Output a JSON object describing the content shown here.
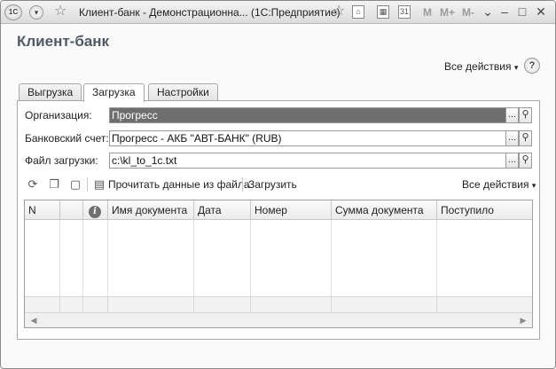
{
  "window": {
    "title": "Клиент-банк - Демонстрационна... (1С:Предприятие)",
    "logo_text": "1С",
    "m_buttons": [
      "M",
      "M+",
      "M-"
    ]
  },
  "form": {
    "title": "Клиент-банк",
    "all_actions": "Все действия",
    "help": "?"
  },
  "tabs": [
    {
      "label": "Выгрузка",
      "active": false
    },
    {
      "label": "Загрузка",
      "active": true
    },
    {
      "label": "Настройки",
      "active": false
    }
  ],
  "fields": {
    "organization": {
      "label": "Организация:",
      "value": "Прогресс"
    },
    "bank_account": {
      "label": "Банковский счет:",
      "value": "Прогресс - АКБ \"АВТ-БАНК\" (RUB)"
    },
    "load_file": {
      "label": "Файл загрузки:",
      "value": "c:\\kl_to_1c.txt"
    }
  },
  "toolbar": {
    "read_file": "Прочитать данные из файла",
    "load": "Загрузить",
    "all_actions": "Все действия"
  },
  "table": {
    "columns": [
      "N",
      "",
      "",
      "Имя документа",
      "Дата",
      "Номер",
      "Сумма документа",
      "Поступило"
    ],
    "rows": []
  },
  "icons": {
    "choose": "...",
    "open": "magnifier-icon"
  }
}
